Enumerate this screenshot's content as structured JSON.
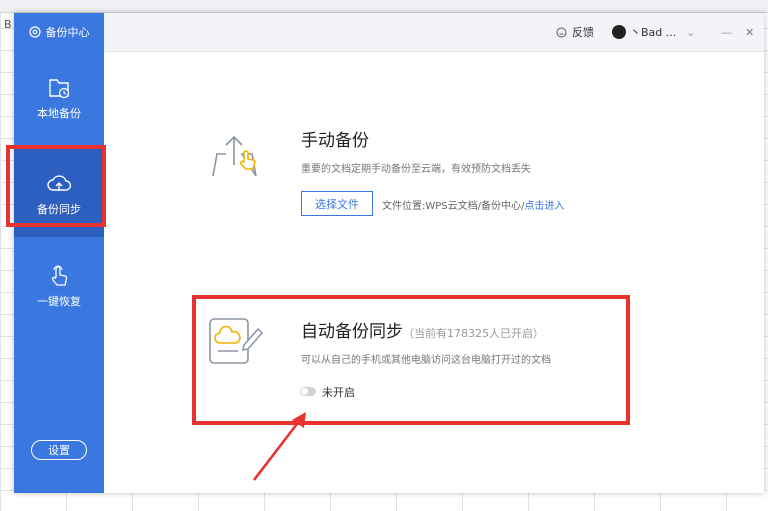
{
  "sheet": {
    "col_letter": "B"
  },
  "sidebar": {
    "brand": "备份中心",
    "items": [
      {
        "label": "本地备份"
      },
      {
        "label": "备份同步"
      },
      {
        "label": "一键恢复"
      }
    ],
    "settings_label": "设置"
  },
  "titlebar": {
    "feedback": "反馈",
    "user": "丶Bad ...",
    "chevron": "⌄",
    "minimize": "—",
    "close": "✕"
  },
  "manual": {
    "title": "手动备份",
    "desc": "重要的文档定期手动备份至云端，有效预防文档丢失",
    "button": "选择文件",
    "location_label": "文件位置:WPS云文档/备份中心/",
    "location_link": "点击进入"
  },
  "auto": {
    "title": "自动备份同步",
    "count": "（当前有178325人已开启）",
    "desc": "可以从自己的手机或其他电脑访问这台电脑打开过的文档",
    "toggle_label": "未开启"
  },
  "colors": {
    "sidebar": "#3a78e0",
    "sidebar_active": "#2c5fbf",
    "highlight": "#e8322f",
    "accent": "#3a78e0"
  }
}
